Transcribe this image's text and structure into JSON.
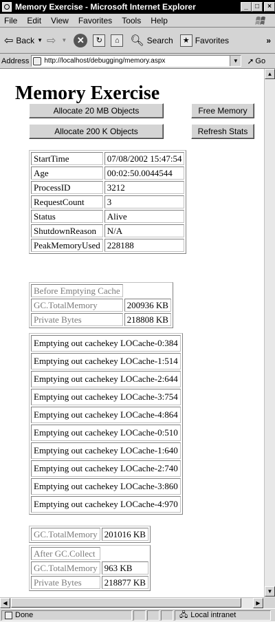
{
  "window": {
    "title": "Memory Exercise - Microsoft Internet Explorer"
  },
  "menu": {
    "items": [
      "File",
      "Edit",
      "View",
      "Favorites",
      "Tools",
      "Help"
    ]
  },
  "toolbar": {
    "back": "Back",
    "search": "Search",
    "favorites": "Favorites"
  },
  "address": {
    "label": "Address",
    "url": "http://localhost/debugging/memory.aspx",
    "go": "Go"
  },
  "page": {
    "title": "Memory Exercise",
    "buttons": {
      "allocate_20mb": "Allocate 20 MB Objects",
      "free_memory": "Free Memory",
      "allocate_200k": "Allocate 200 K Objects",
      "refresh_stats": "Refresh Stats"
    },
    "stats": [
      {
        "label": "StartTime",
        "value": "07/08/2002 15:47:54"
      },
      {
        "label": "Age",
        "value": "00:02:50.0044544"
      },
      {
        "label": "ProcessID",
        "value": "3212"
      },
      {
        "label": "RequestCount",
        "value": "3"
      },
      {
        "label": "Status",
        "value": "Alive"
      },
      {
        "label": "ShutdownReason",
        "value": "N/A"
      },
      {
        "label": "PeakMemoryUsed",
        "value": "228188"
      }
    ],
    "before_cache": {
      "heading": "Before Emptying Cache",
      "rows": [
        {
          "label": "GC.TotalMemory",
          "value": "200936 KB"
        },
        {
          "label": "Private Bytes",
          "value": "218808 KB"
        }
      ]
    },
    "cache_lines": [
      "Emptying out cachekey LOCache-0:384",
      "Emptying out cachekey LOCache-1:514",
      "Emptying out cachekey LOCache-2:644",
      "Emptying out cachekey LOCache-3:754",
      "Emptying out cachekey LOCache-4:864",
      "Emptying out cachekey LOCache-0:510",
      "Emptying out cachekey LOCache-1:640",
      "Emptying out cachekey LOCache-2:740",
      "Emptying out cachekey LOCache-3:860",
      "Emptying out cachekey LOCache-4:970"
    ],
    "after_empty": {
      "label": "GC.TotalMemory",
      "value": "201016 KB"
    },
    "after_collect": {
      "heading": "After GC.Collect",
      "rows": [
        {
          "label": "GC.TotalMemory",
          "value": "963 KB"
        },
        {
          "label": "Private Bytes",
          "value": "218877 KB"
        }
      ]
    }
  },
  "status": {
    "text": "Done",
    "zone": "Local intranet"
  }
}
